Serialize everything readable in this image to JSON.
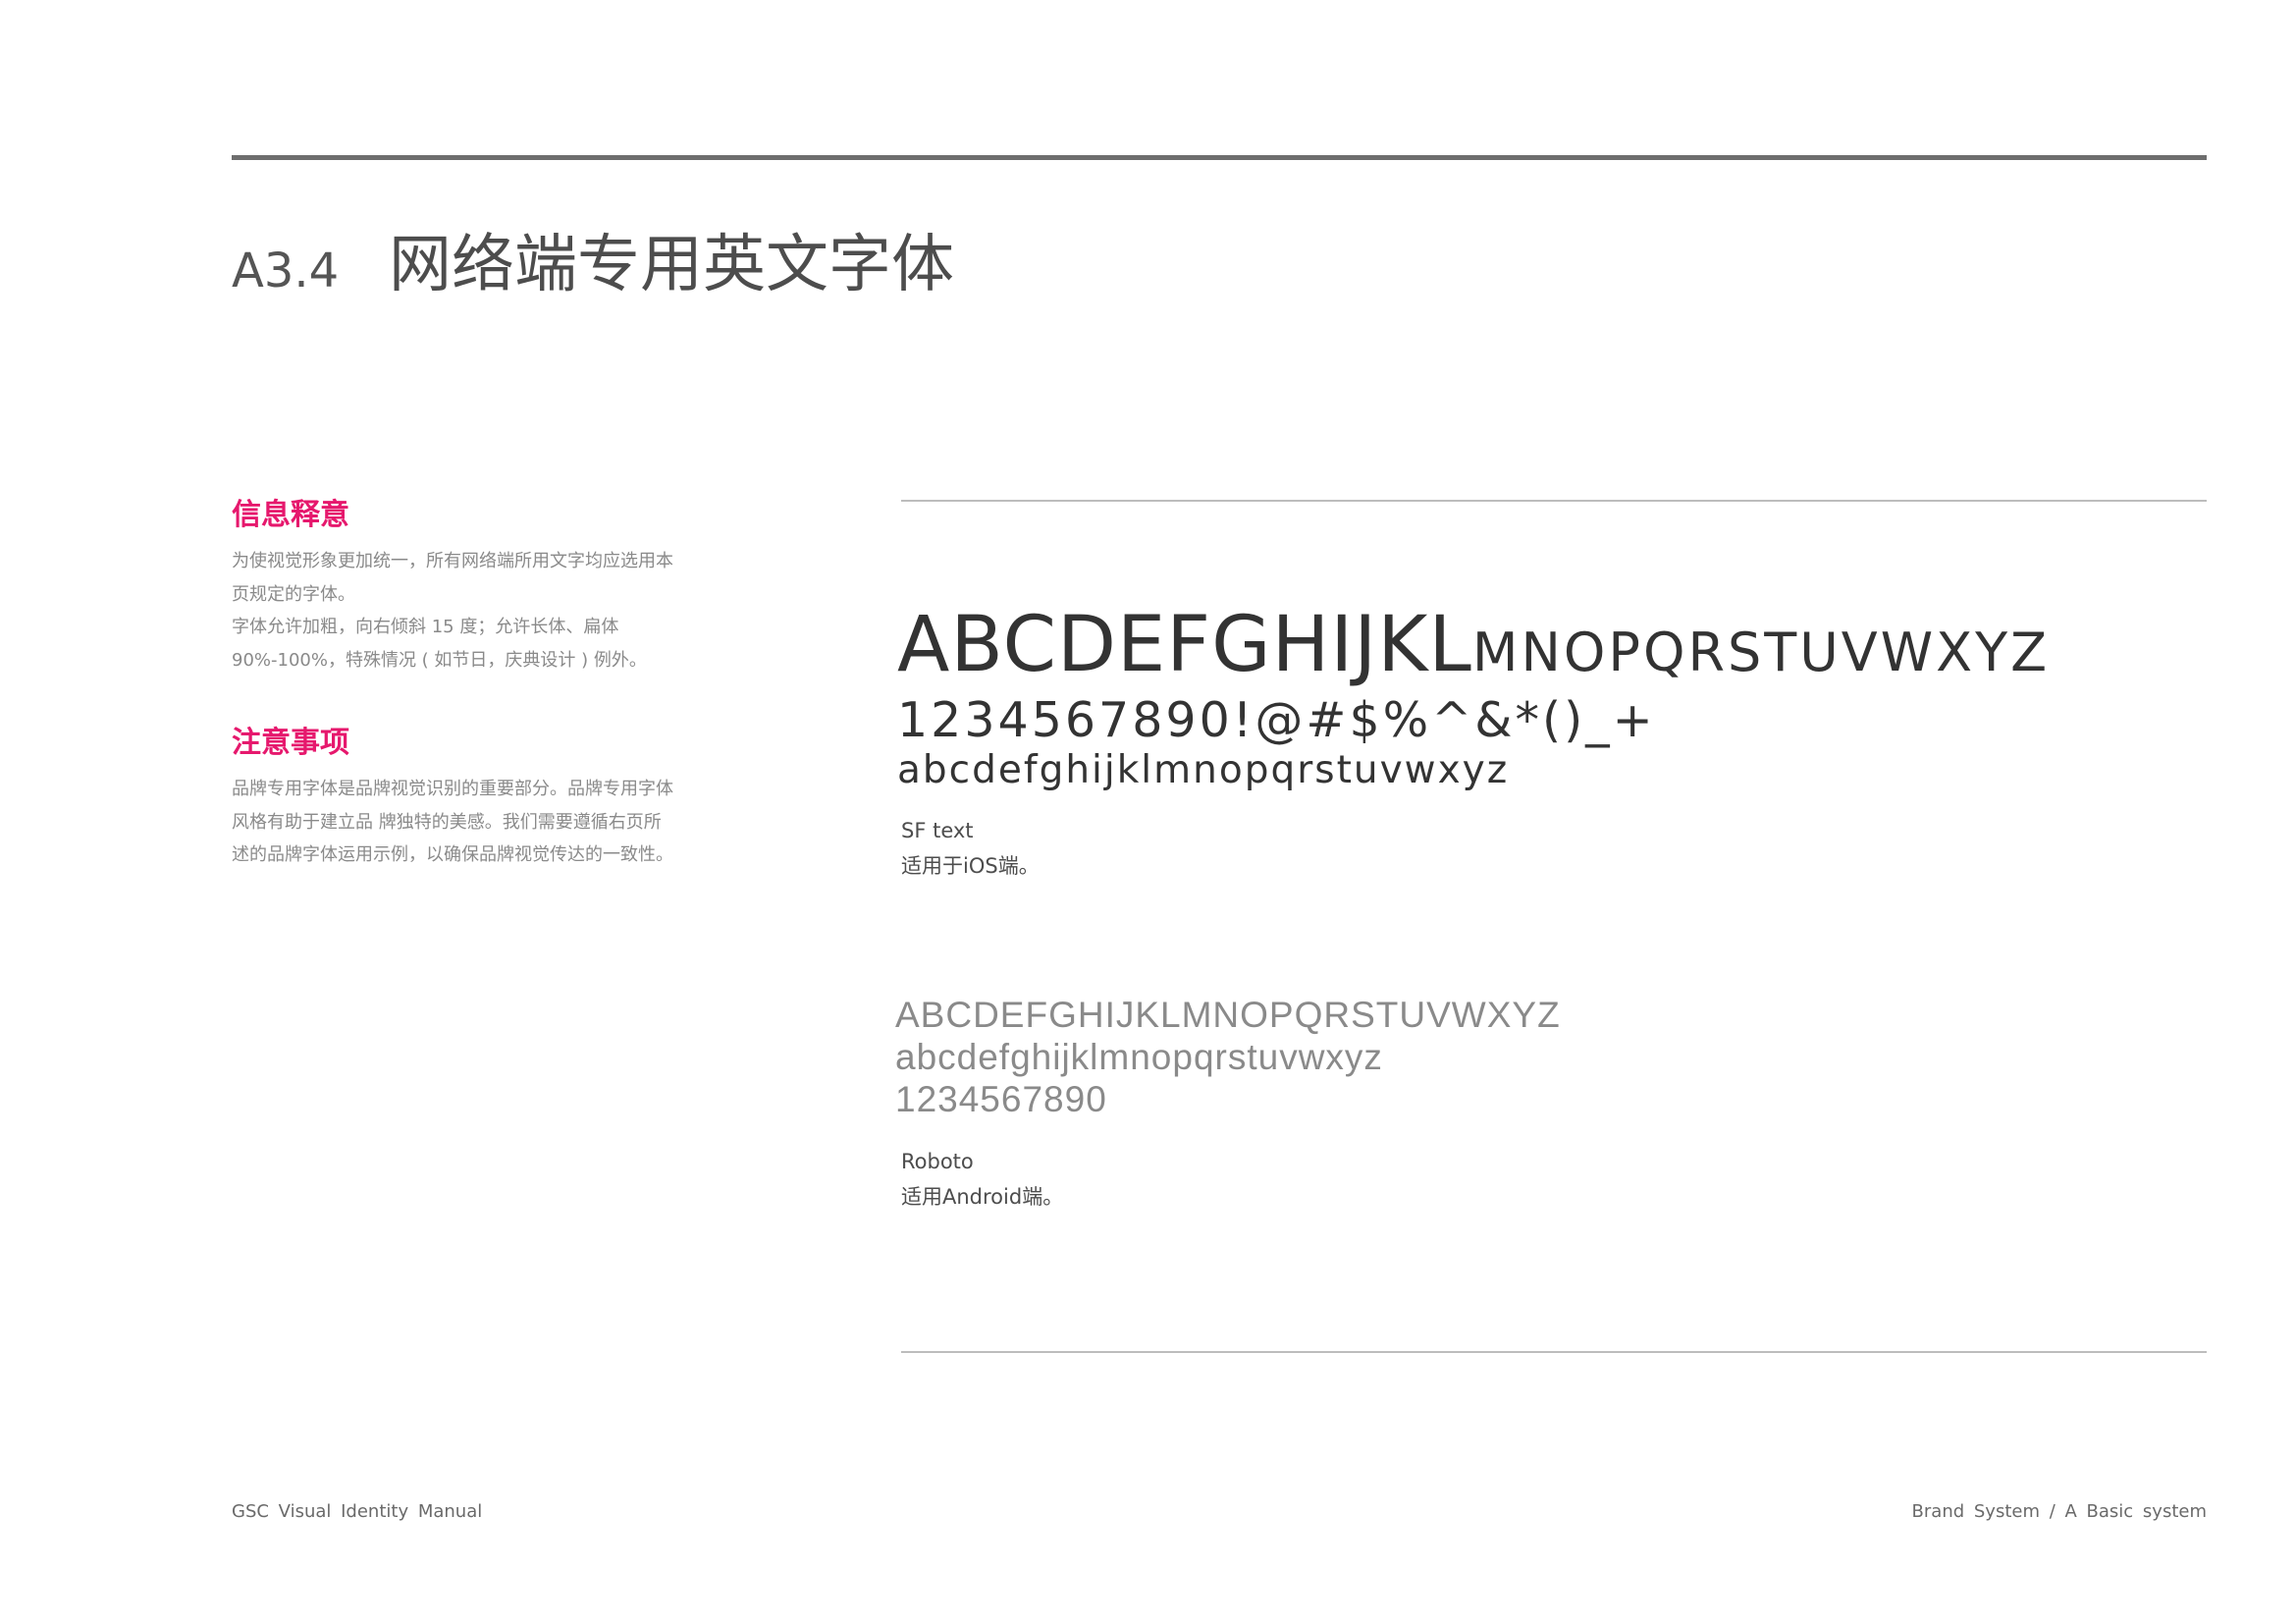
{
  "header": {
    "section_code": "A3.4",
    "section_title": "网络端专用英文字体"
  },
  "info": {
    "heading": "信息释意",
    "lines": [
      "为使视觉形象更加统一，所有网络端所用文字均应选用本",
      "页规定的字体。",
      "字体允许加粗，向右倾斜 15 度；允许长体、扁体",
      "90%-100%，特殊情况 ( 如节日，庆典设计 ) 例外。"
    ]
  },
  "notes": {
    "heading": "注意事项",
    "lines": [
      "品牌专用字体是品牌视觉识别的重要部分。品牌专用字体",
      "风格有助于建立品 牌独特的美感。我们需要遵循右页所",
      "述的品牌字体运用示例，以确保品牌视觉传达的一致性。"
    ]
  },
  "sf_specimen": {
    "upper_large": "ABCDEFGHIJKL",
    "upper_small": "MNOPQRSTUVWXYZ",
    "digits_symbols": "1234567890!@#$%^&*()_+",
    "lower": "abcdefghijklmnopqrstuvwxyz",
    "font_name": "SF text",
    "usage": "适用于iOS端。"
  },
  "roboto_specimen": {
    "upper": "ABCDEFGHIJKLMNOPQRSTUVWXYZ",
    "lower": "abcdefghijklmnopqrstuvwxyz",
    "digits": "1234567890",
    "font_name": "Roboto",
    "usage": "适用Android端。"
  },
  "footer": {
    "left": "GSC Visual Identity Manual",
    "right": "Brand System / A Basic system"
  },
  "colors": {
    "accent": "#e6186d",
    "rule_dark": "#6e6e6e",
    "rule_light": "#bdbdbd",
    "body_text": "#8a8a8a",
    "specimen_text": "#333333"
  }
}
